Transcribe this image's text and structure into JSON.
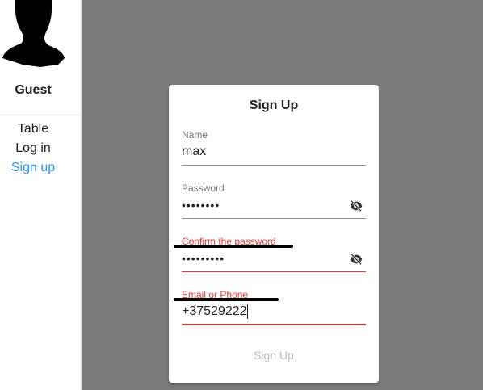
{
  "sidebar": {
    "username": "Guest",
    "avatar_icon": "user-silhouette-icon",
    "nav": [
      {
        "label": "Table",
        "active": false
      },
      {
        "label": "Log in",
        "active": false
      },
      {
        "label": "Sign up",
        "active": true
      }
    ]
  },
  "form": {
    "title": "Sign Up",
    "fields": {
      "name": {
        "label": "Name",
        "value": "max"
      },
      "password": {
        "label": "Password",
        "value": "••••••••",
        "icon": "eye-off-icon"
      },
      "confirm_password": {
        "label": "Confirm the password",
        "value": "•••••••••",
        "icon": "eye-off-icon",
        "state": "error"
      },
      "email_or_phone": {
        "label": "Email or Phone",
        "value": "+37529222",
        "state": "error"
      }
    },
    "submit_label": "Sign Up",
    "submit_disabled": true
  },
  "colors": {
    "backdrop": "#7a7a7b",
    "accent": "#2196f3",
    "error": "#e53935",
    "disabled": "#bdbdbd"
  }
}
